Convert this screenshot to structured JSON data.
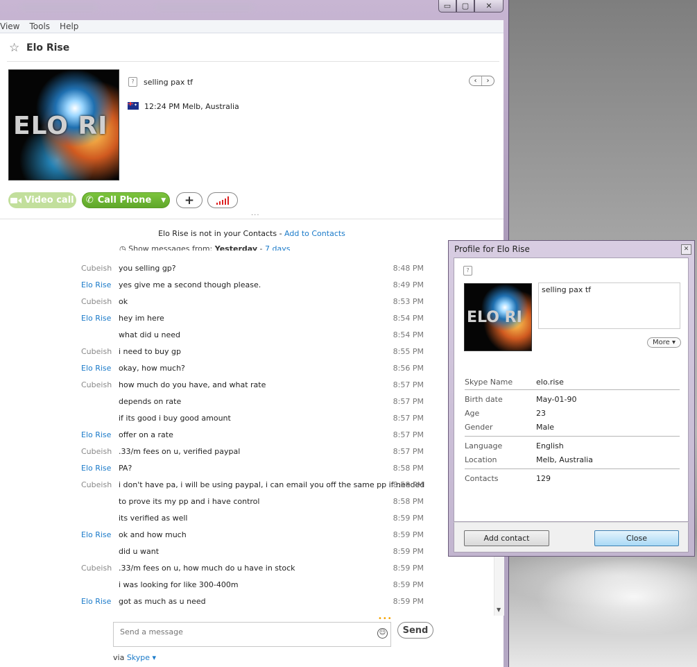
{
  "window": {
    "menu": [
      "View",
      "Tools",
      "Help"
    ],
    "controls": {
      "minimize": "▭",
      "maximize": "▢",
      "close": "✕"
    }
  },
  "contact": {
    "name": "Elo Rise",
    "avatar_text": "ELO RI",
    "mood": "selling pax tf",
    "local_time": "12:24 PM Melb, Australia"
  },
  "actions": {
    "video_call": "Video call",
    "call_phone": "Call Phone",
    "add": "+",
    "grip": "..."
  },
  "notice": {
    "text": "Elo Rise is not in your Contacts - ",
    "link": "Add to Contacts"
  },
  "history": {
    "prefix": "Show messages from:",
    "selected": "Yesterday",
    "sep": "-",
    "link": "7 days"
  },
  "messages": [
    {
      "from": "Cubeish",
      "text": "you selling gp?",
      "time": "8:48 PM",
      "self": true
    },
    {
      "from": "Elo Rise",
      "text": "yes give me a second though please.",
      "time": "8:49 PM",
      "self": false
    },
    {
      "from": "Cubeish",
      "text": "ok",
      "time": "8:53 PM",
      "self": true
    },
    {
      "from": "Elo Rise",
      "text": "hey im here",
      "time": "8:54 PM",
      "self": false
    },
    {
      "from": "",
      "text": "what did u need",
      "time": "8:54 PM",
      "self": false
    },
    {
      "from": "Cubeish",
      "text": "i need to buy gp",
      "time": "8:55 PM",
      "self": true
    },
    {
      "from": "Elo Rise",
      "text": "okay, how much?",
      "time": "8:56 PM",
      "self": false
    },
    {
      "from": "Cubeish",
      "text": "how much do you have, and what rate",
      "time": "8:57 PM",
      "self": true
    },
    {
      "from": "",
      "text": "depends on rate",
      "time": "8:57 PM",
      "self": true
    },
    {
      "from": "",
      "text": "if its good i buy good amount",
      "time": "8:57 PM",
      "self": true
    },
    {
      "from": "Elo Rise",
      "text": "offer on a rate",
      "time": "8:57 PM",
      "self": false
    },
    {
      "from": "Cubeish",
      "text": ".33/m fees on u, verified paypal",
      "time": "8:57 PM",
      "self": true
    },
    {
      "from": "Elo Rise",
      "text": "PA?",
      "time": "8:58 PM",
      "self": false
    },
    {
      "from": "Cubeish",
      "text": "i don't have pa, i will be using paypal, i can email you off the same pp if needed",
      "time": "8:58 PM",
      "self": true
    },
    {
      "from": "",
      "text": "to prove its my pp and i have control",
      "time": "8:58 PM",
      "self": true
    },
    {
      "from": "",
      "text": "its verified as well",
      "time": "8:59 PM",
      "self": true
    },
    {
      "from": "Elo Rise",
      "text": "ok and how much",
      "time": "8:59 PM",
      "self": false
    },
    {
      "from": "",
      "text": "did u want",
      "time": "8:59 PM",
      "self": false
    },
    {
      "from": "Cubeish",
      "text": ".33/m fees on u, how much do u have in stock",
      "time": "8:59 PM",
      "self": true
    },
    {
      "from": "",
      "text": "i was looking for like 300-400m",
      "time": "8:59 PM",
      "self": true
    },
    {
      "from": "Elo Rise",
      "text": "got as much as u need",
      "time": "8:59 PM",
      "self": false
    }
  ],
  "compose": {
    "placeholder": "Send a message",
    "send": "Send",
    "via": "via",
    "via_link": "Skype ▾"
  },
  "profile": {
    "title": "Profile for Elo Rise",
    "mood": "selling pax tf",
    "more": "More ▾",
    "fields": [
      {
        "k": "Skype Name",
        "v": "elo.rise"
      },
      {
        "k": "Birth date",
        "v": "May-01-90"
      },
      {
        "k": "Age",
        "v": "23"
      },
      {
        "k": "Gender",
        "v": "Male"
      },
      {
        "k": "Language",
        "v": "English"
      },
      {
        "k": "Location",
        "v": "Melb, Australia"
      },
      {
        "k": "Contacts",
        "v": "129"
      }
    ],
    "add_contact": "Add contact",
    "close": "Close"
  }
}
